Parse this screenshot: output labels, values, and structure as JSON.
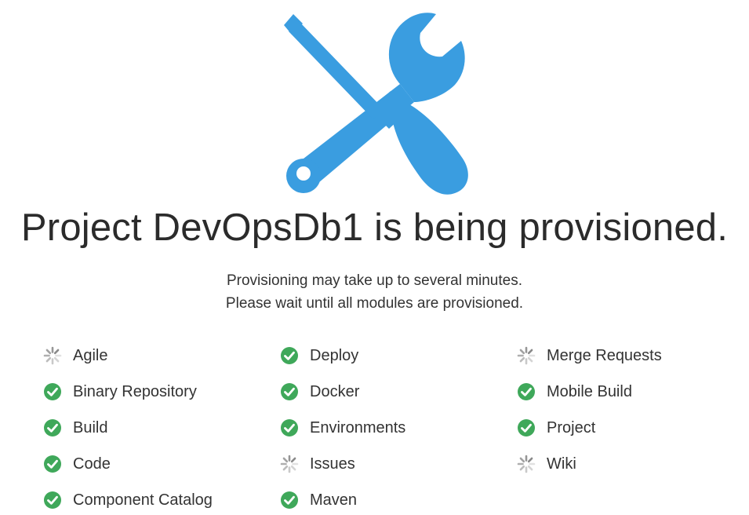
{
  "header": {
    "icon": "tools-icon",
    "icon_color": "#3a9de0",
    "title": "Project DevOpsDb1 is being provisioned.",
    "subtitle_lines": [
      "Provisioning may take up to several minutes.",
      "Please wait until all modules are provisioned."
    ]
  },
  "colors": {
    "done": "#3fa85a",
    "pending": "#8a8a8a"
  },
  "modules": {
    "columns": [
      [
        {
          "label": "Agile",
          "status": "pending",
          "icon": "spinner-icon"
        },
        {
          "label": "Binary Repository",
          "status": "done",
          "icon": "check-circle-icon"
        },
        {
          "label": "Build",
          "status": "done",
          "icon": "check-circle-icon"
        },
        {
          "label": "Code",
          "status": "done",
          "icon": "check-circle-icon"
        },
        {
          "label": "Component Catalog",
          "status": "done",
          "icon": "check-circle-icon"
        }
      ],
      [
        {
          "label": "Deploy",
          "status": "done",
          "icon": "check-circle-icon"
        },
        {
          "label": "Docker",
          "status": "done",
          "icon": "check-circle-icon"
        },
        {
          "label": "Environments",
          "status": "done",
          "icon": "check-circle-icon"
        },
        {
          "label": "Issues",
          "status": "pending",
          "icon": "spinner-icon"
        },
        {
          "label": "Maven",
          "status": "done",
          "icon": "check-circle-icon"
        }
      ],
      [
        {
          "label": "Merge Requests",
          "status": "pending",
          "icon": "spinner-icon"
        },
        {
          "label": "Mobile Build",
          "status": "done",
          "icon": "check-circle-icon"
        },
        {
          "label": "Project",
          "status": "done",
          "icon": "check-circle-icon"
        },
        {
          "label": "Wiki",
          "status": "pending",
          "icon": "spinner-icon"
        }
      ]
    ]
  }
}
